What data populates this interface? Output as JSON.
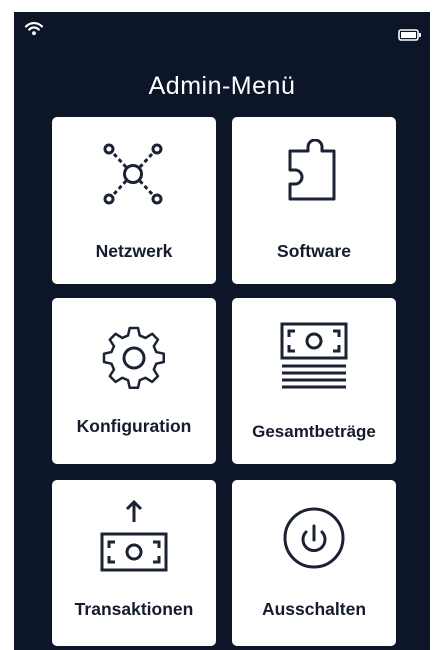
{
  "screen": {
    "title": "Admin-Menü",
    "status_icons": {
      "left": "wifi-icon",
      "right": "battery-icon"
    }
  },
  "tiles": [
    {
      "label": "Netzwerk",
      "icon": "network-icon"
    },
    {
      "label": "Software",
      "icon": "puzzle-piece-icon"
    },
    {
      "label": "Konfiguration",
      "icon": "gear-icon"
    },
    {
      "label": "Gesamtbeträge",
      "icon": "banknote-stack-icon"
    },
    {
      "label": "Transaktionen",
      "icon": "banknote-upload-icon"
    },
    {
      "label": "Ausschalten",
      "icon": "power-icon"
    }
  ],
  "colors": {
    "background": "#0d1628",
    "tile": "#ffffff",
    "tile_text": "#141c2e",
    "icon_stroke": "#1a2233",
    "title_text": "#ffffff"
  }
}
